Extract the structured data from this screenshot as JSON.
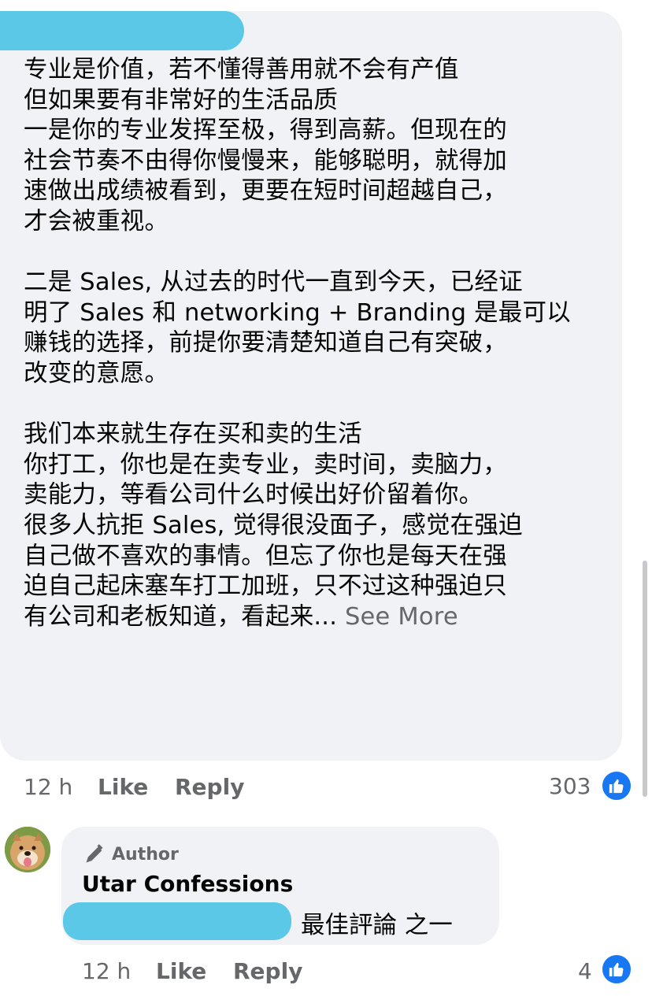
{
  "comment": {
    "body": "专业是价值，若不懂得善用就不会有产值\n但如果要有非常好的生活品质\n一是你的专业发挥至极，得到高薪。但现在的\n社会节奏不由得你慢慢来，能够聪明，就得加\n速做出成绩被看到，更要在短时间超越自己，\n才会被重视。\n\n二是 Sales, 从过去的时代一直到今天，已经证\n明了 Sales 和 networking + Branding 是最可以\n赚钱的选择，前提你要清楚知道自己有突破，\n改变的意愿。\n\n我们本来就生存在买和卖的生活\n你打工，你也是在卖专业，卖时间，卖脑力，\n卖能力，等看公司什么时候出好价留着你。\n很多人抗拒 Sales, 觉得很没面子，感觉在强迫\n自己做不喜欢的事情。但忘了你也是每天在强\n迫自己起床塞车打工加班，只不过这种强迫只\n有公司和老板知道，看起来...",
    "see_more": " See More",
    "time": "12 h",
    "like_label": "Like",
    "reply_label": "Reply",
    "reaction_count": "303"
  },
  "reply": {
    "author_badge": "Author",
    "name": "Utar Confessions",
    "text": "最佳評論 之一",
    "time": "12 h",
    "like_label": "Like",
    "reply_label": "Reply",
    "reaction_count": "4"
  },
  "colors": {
    "bubble": "#f0f2f5",
    "redaction": "#5ac8e6",
    "like_blue": "#1877f2",
    "meta_gray": "#65676b"
  }
}
